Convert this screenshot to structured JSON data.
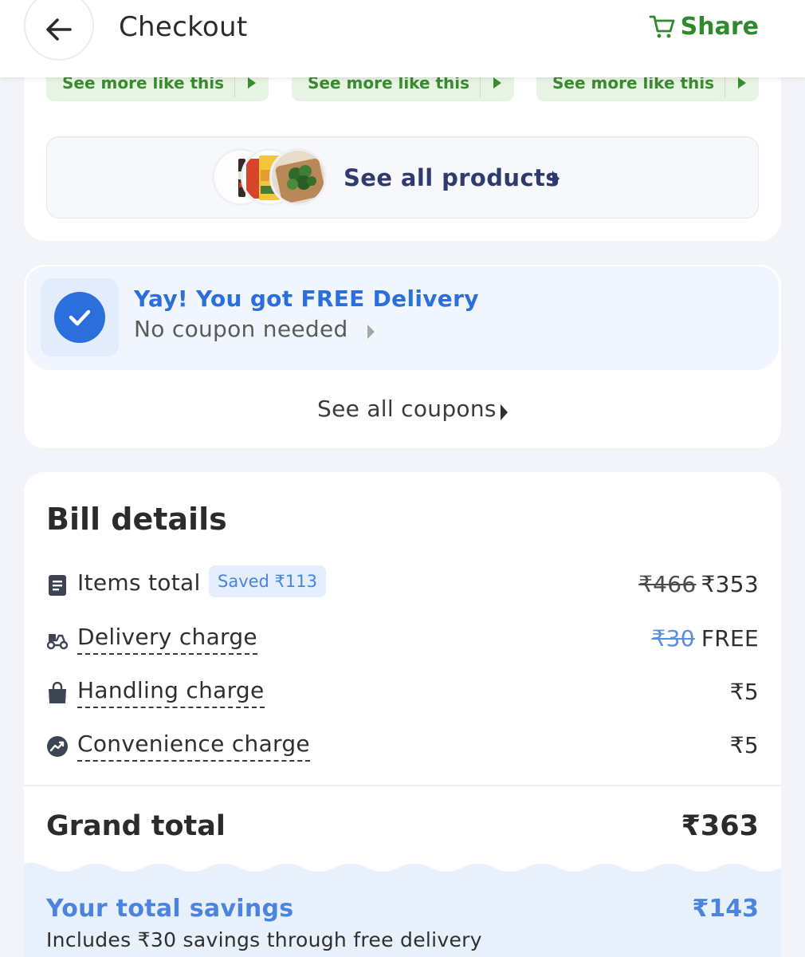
{
  "header": {
    "title": "Checkout",
    "share_label": "Share",
    "accent": "#2e8a2c"
  },
  "products": {
    "more_buttons": [
      {
        "label": "See more like this"
      },
      {
        "label": "See more like this"
      },
      {
        "label": "See more like this"
      }
    ],
    "see_all_label": "See all products"
  },
  "coupon": {
    "free_title": "Yay! You got FREE Delivery",
    "free_sub": "No coupon needed",
    "see_all_label": "See all coupons",
    "accent": "#2a6fdc"
  },
  "bill": {
    "title": "Bill details",
    "rows": [
      {
        "icon": "receipt-icon",
        "label": "Items total",
        "badge": "Saved ₹113",
        "old_price": "₹466",
        "price": "₹353"
      },
      {
        "icon": "scooter-icon",
        "label": "Delivery charge",
        "old_price": "₹30",
        "price": "FREE"
      },
      {
        "icon": "shopping-bag-icon",
        "label": "Handling charge",
        "price": "₹5"
      },
      {
        "icon": "trending-up-icon",
        "label": "Convenience charge",
        "price": "₹5"
      }
    ],
    "grand_total_label": "Grand total",
    "grand_total_value": "₹363",
    "savings_title": "Your total savings",
    "savings_value": "₹143",
    "savings_sub": "Includes ₹30 savings through free delivery"
  }
}
